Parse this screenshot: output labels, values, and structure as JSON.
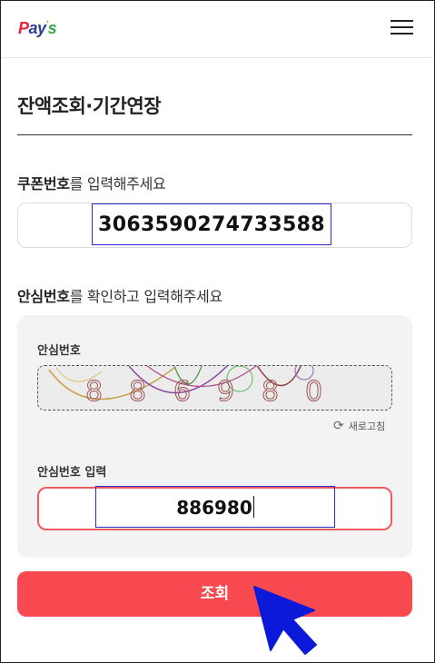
{
  "header": {
    "logo": {
      "p": "P",
      "ay": "ay",
      "apos": "'",
      "s": "s"
    }
  },
  "page": {
    "title": "잔액조회·기간연장"
  },
  "coupon": {
    "label_bold": "쿠폰번호",
    "label_rest": "를 입력해주세요",
    "value": "3063590274733588"
  },
  "security": {
    "label_bold": "안심번호",
    "label_rest": "를 확인하고 입력해주세요",
    "captcha_label": "안심번호",
    "captcha_digits": [
      "8",
      "8",
      "6",
      "9",
      "8",
      "0"
    ],
    "refresh_label": "새로고침",
    "input_label": "안심번호 입력",
    "input_value": "886980"
  },
  "submit": {
    "label": "조회"
  },
  "colors": {
    "accent": "#f7494f",
    "input_border": "#ef5a5f",
    "focus_outline": "#2b2bd0",
    "cursor": "#0a1ad8"
  }
}
